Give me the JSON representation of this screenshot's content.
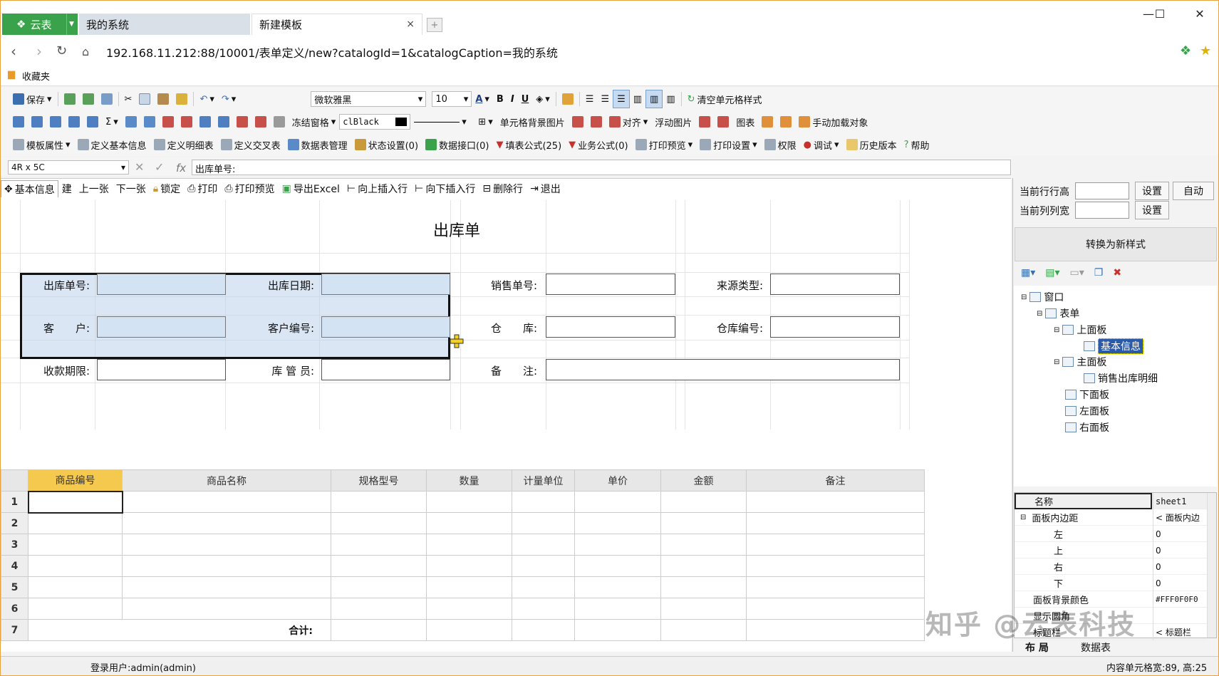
{
  "browser": {
    "brand": "云表",
    "tabs": [
      {
        "label": "我的系统"
      },
      {
        "label": "新建模板",
        "close": "×"
      }
    ],
    "new_tab_icon": "plus-icon",
    "window_controls": [
      "—",
      "☐",
      "✕"
    ],
    "url": "192.168.11.212:88/10001/表单定义/new?catalogId=1&catalogCaption=我的系统",
    "bookmarks_label": "收藏夹"
  },
  "toolbar1": {
    "save": "保存",
    "font": "微软雅黑",
    "font_size": "10",
    "bold": "B",
    "italic": "I",
    "underline": "U",
    "clear_format": "清空单元格样式"
  },
  "toolbar2": {
    "freeze": "冻结窗格",
    "color_value": "clBlack",
    "cell_bg_image": "单元格背景图片",
    "align": "对齐",
    "float_image": "浮动图片",
    "chart": "图表",
    "manual_load": "手动加载对象"
  },
  "toolbar3": {
    "template_props": "模板属性",
    "define_basic": "定义基本信息",
    "define_detail": "定义明细表",
    "define_cross": "定义交叉表",
    "data_table_mgmt": "数据表管理",
    "state_settings": "状态设置(0)",
    "data_interface": "数据接口(0)",
    "fill_formula": "填表公式(25)",
    "business_formula": "业务公式(0)",
    "print_preview": "打印预览",
    "print_settings": "打印设置",
    "permissions": "权限",
    "debug": "调试",
    "history": "历史版本",
    "help": "帮助"
  },
  "formula_bar": {
    "cell_ref": "4R x 5C",
    "fx": "fx",
    "content": "出库单号:"
  },
  "action_bar": {
    "basic_info_tab": "基本信息",
    "new_partial": "建",
    "prev": "上一张",
    "next": "下一张",
    "lock": "锁定",
    "print": "打印",
    "print_preview": "打印预览",
    "export_excel": "导出Excel",
    "insert_up": "向上插入行",
    "insert_down": "向下插入行",
    "delete_row": "删除行",
    "exit": "退出"
  },
  "form": {
    "title": "出库单",
    "labels": {
      "order_no": "出库单号:",
      "out_date": "出库日期:",
      "sales_no": "销售单号:",
      "source_type": "来源类型:",
      "customer": "客　　户:",
      "customer_no": "客户编号:",
      "warehouse": "仓　　库:",
      "warehouse_no": "仓库编号:",
      "payment_term": "收款期限:",
      "keeper": "库 管 员:",
      "remark": "备　　注:"
    }
  },
  "detail_table": {
    "columns": [
      "商品编号",
      "商品名称",
      "规格型号",
      "数量",
      "计量单位",
      "单价",
      "金额",
      "备注"
    ],
    "row_numbers": [
      "1",
      "2",
      "3",
      "4",
      "5",
      "6",
      "7"
    ],
    "sum_label": "合计:"
  },
  "right_panel": {
    "row_height_label": "当前行行高",
    "col_width_label": "当前列列宽",
    "set": "设置",
    "auto": "自动",
    "convert": "转换为新样式",
    "tree": [
      {
        "label": "窗口"
      },
      {
        "label": "表单"
      },
      {
        "label": "上面板"
      },
      {
        "label": "基本信息"
      },
      {
        "label": "主面板"
      },
      {
        "label": "销售出库明细"
      },
      {
        "label": "下面板"
      },
      {
        "label": "左面板"
      },
      {
        "label": "右面板"
      }
    ],
    "props": [
      {
        "k": "名称",
        "v": "sheet1"
      },
      {
        "k": "面板内边距",
        "v": "< 面板内边"
      },
      {
        "k": "左",
        "v": "0"
      },
      {
        "k": "上",
        "v": "0"
      },
      {
        "k": "右",
        "v": "0"
      },
      {
        "k": "下",
        "v": "0"
      },
      {
        "k": "面板背景颜色",
        "v": "#FFF0F0F0"
      },
      {
        "k": "显示圆角",
        "v": ""
      },
      {
        "k": "标题栏",
        "v": "< 标题栏"
      }
    ],
    "bottom_tabs": [
      "布 局",
      "数据表"
    ]
  },
  "status": {
    "user": "登录用户:admin(admin)",
    "cell_info": "内容单元格宽:89, 高:25"
  },
  "watermark": "知乎 @云表科技",
  "colors": {
    "brand": "#3aa24a",
    "selection": "#d4e3f3",
    "header_highlight": "#f5c94d"
  }
}
